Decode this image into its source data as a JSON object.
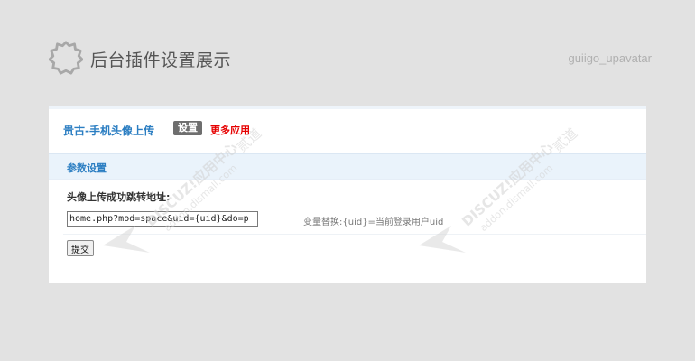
{
  "header": {
    "title": "后台插件设置展示",
    "plugin_id": "guiigo_upavatar"
  },
  "panel": {
    "plugin_name": "贵古-手机头像上传",
    "settings_tab": "设置",
    "more_apps_link": "更多应用"
  },
  "section": {
    "title": "参数设置"
  },
  "form": {
    "field_label": "头像上传成功跳转地址:",
    "redirect_value": "home.php?mod=space&uid={uid}&do=p",
    "hint": "变量替换:{uid}=当前登录用户uid",
    "submit_label": "提交"
  },
  "watermark": {
    "line1": "DISCUZ!应用中心",
    "line2": "addon.dismall.com",
    "brand": "贰道"
  },
  "colors": {
    "background": "#e2e2e2",
    "link_blue": "#2b7ec2",
    "accent_red": "#e60000",
    "tab_gray": "#6e6e6e"
  }
}
